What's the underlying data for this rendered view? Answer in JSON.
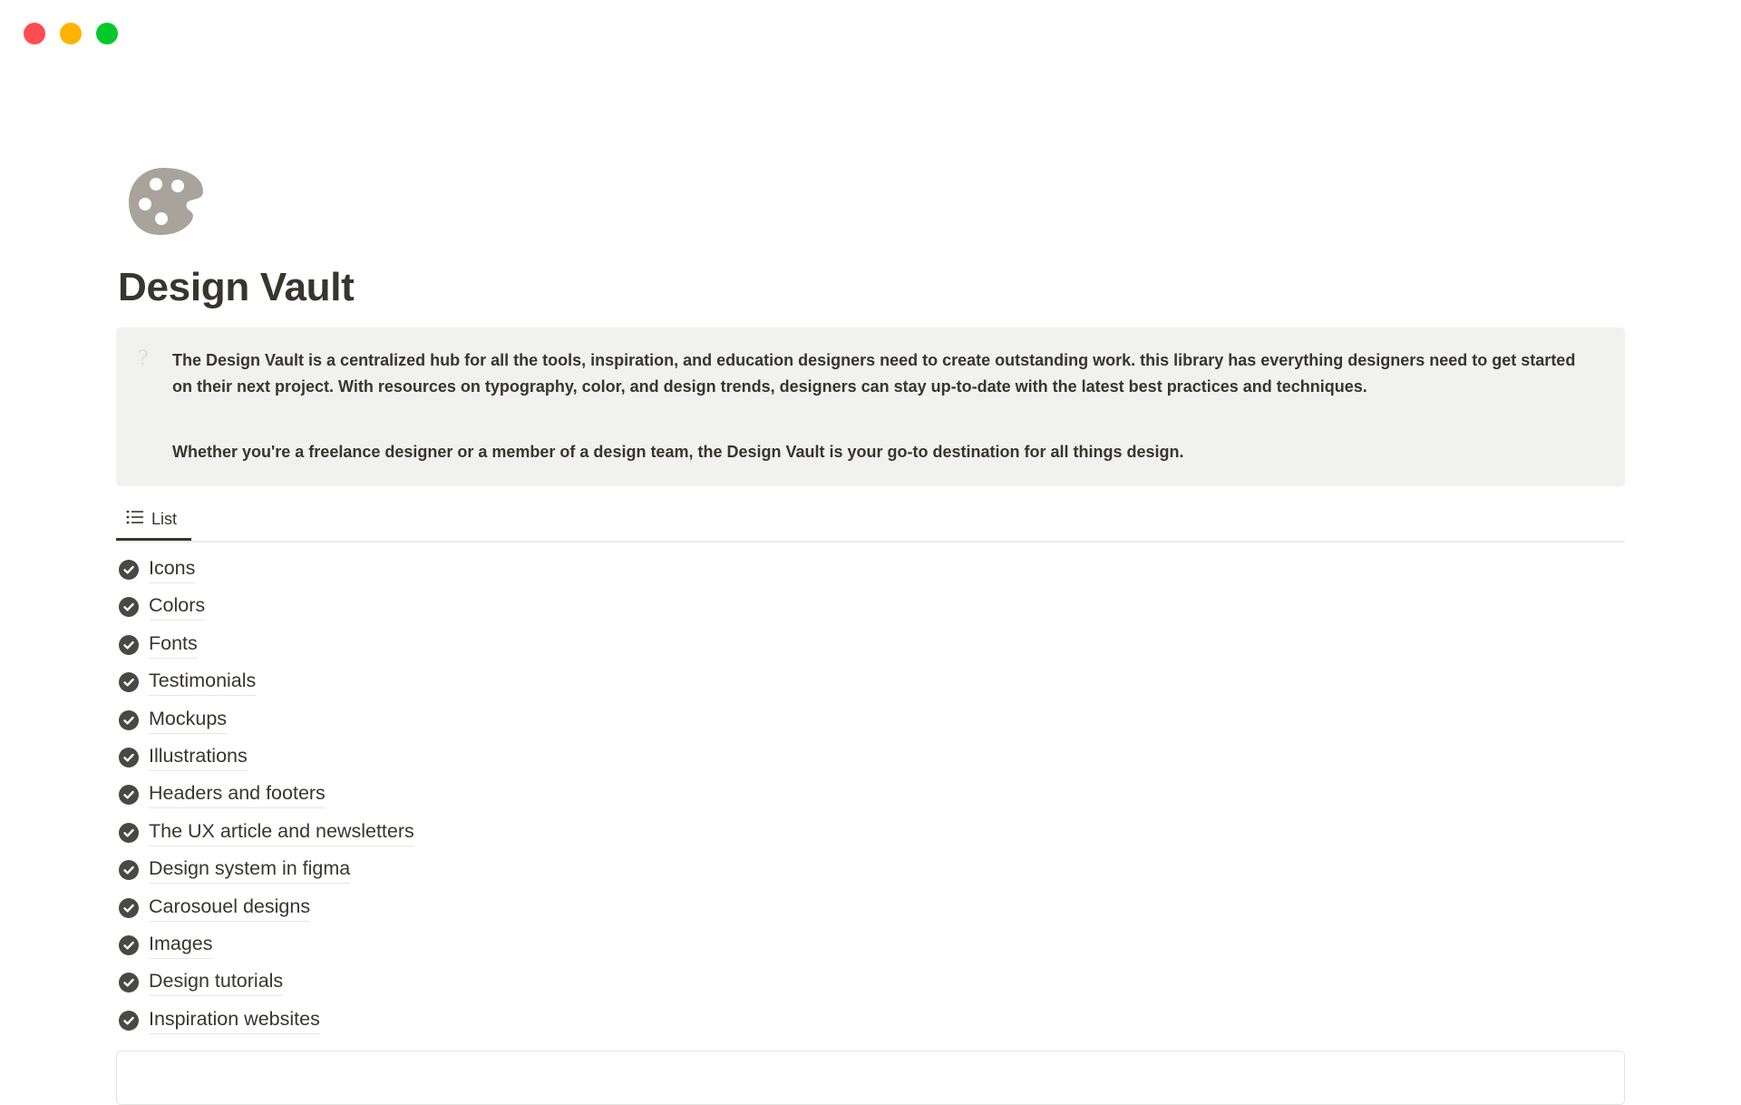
{
  "window": {
    "controls": [
      "close",
      "minimize",
      "maximize"
    ],
    "colors": {
      "close": "#ff4c52",
      "minimize": "#ffb300",
      "maximize": "#00c92a"
    }
  },
  "page": {
    "icon": "palette-icon",
    "title": "Design Vault"
  },
  "callout": {
    "icon": "question-mark-icon",
    "icon_glyph": "?",
    "paragraphs": [
      "The Design Vault is a centralized hub for all the tools, inspiration, and education designers need to create outstanding work. this library has everything designers need to get started on their next project. With resources on typography, color, and design trends, designers can stay up-to-date with the latest best practices and techniques.",
      "Whether you're a freelance designer or a member of a design team, the Design Vault is your go-to destination for all things design."
    ]
  },
  "view_tabs": [
    {
      "label": "List",
      "icon": "list-icon",
      "active": true
    }
  ],
  "list": {
    "items": [
      {
        "label": "Icons",
        "icon": "check-circle-icon"
      },
      {
        "label": "Colors",
        "icon": "check-circle-icon"
      },
      {
        "label": "Fonts",
        "icon": "check-circle-icon"
      },
      {
        "label": "Testimonials",
        "icon": "check-circle-icon"
      },
      {
        "label": "Mockups",
        "icon": "check-circle-icon"
      },
      {
        "label": "Illustrations",
        "icon": "check-circle-icon"
      },
      {
        "label": "Headers and footers",
        "icon": "check-circle-icon"
      },
      {
        "label": "The UX article and newsletters",
        "icon": "check-circle-icon"
      },
      {
        "label": "Design system in figma",
        "icon": "check-circle-icon"
      },
      {
        "label": "Carosouel designs",
        "icon": "check-circle-icon"
      },
      {
        "label": "Images",
        "icon": "check-circle-icon"
      },
      {
        "label": "Design tutorials",
        "icon": "check-circle-icon"
      },
      {
        "label": "Inspiration websites",
        "icon": "check-circle-icon"
      }
    ]
  },
  "colors": {
    "text": "#37352f",
    "callout_bg": "#f1f1ef",
    "icon_gray": "#a8a49c",
    "check_fill": "#4a4844"
  }
}
